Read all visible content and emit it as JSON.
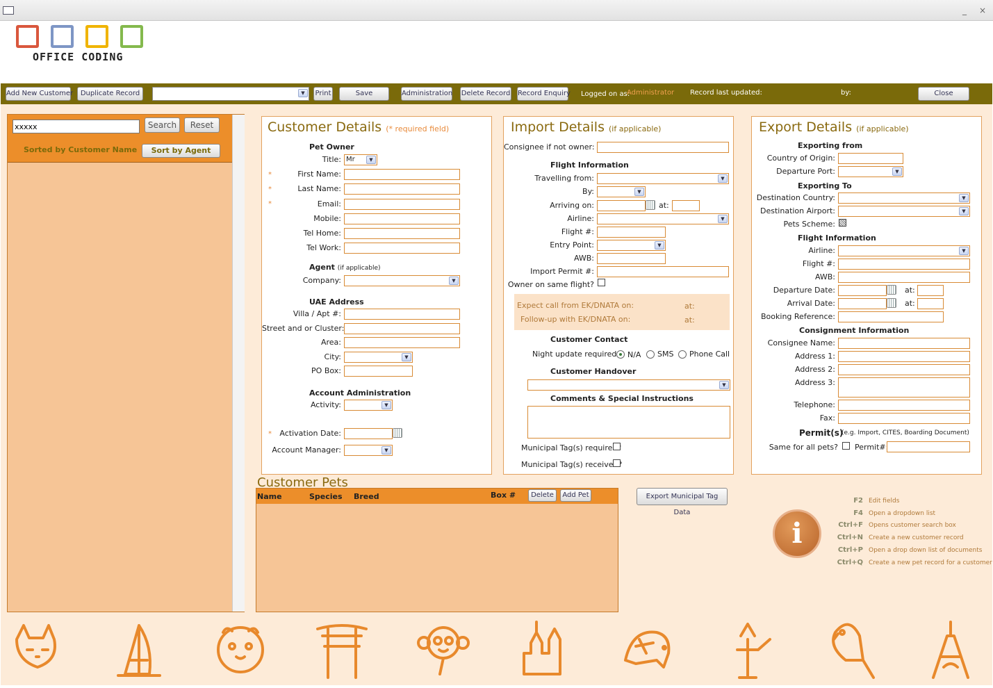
{
  "window": {
    "title_icon": "db-form-icon",
    "minimize": "_",
    "close": "×"
  },
  "logo": {
    "text": "OFFICE CODING",
    "colors": [
      "#d9573d",
      "#7e96c5",
      "#f0b400",
      "#84b94d"
    ]
  },
  "toolbar": {
    "add_new_customer": "Add New Customer",
    "duplicate_record": "Duplicate Record",
    "document_select": "",
    "print": "Print",
    "save": "Save",
    "administration": "Administration",
    "delete_record": "Delete Record",
    "record_enquiry": "Record Enquiry",
    "logged_on_as_label": "Logged on as:",
    "logged_on_as_value": "Administrator",
    "record_last_updated_label": "Record last updated:",
    "by_label": "by:",
    "close": "Close"
  },
  "search": {
    "value": "xxxxx",
    "search_btn": "Search",
    "reset_btn": "Reset",
    "sorted_label": "Sorted by Customer Name",
    "sort_btn": "Sort by Agent"
  },
  "customer": {
    "title": "Customer Details",
    "required_note": "(* required field)",
    "pet_owner": "Pet Owner",
    "title_label": "Title:",
    "title_value": "Mr",
    "first_name": "First Name:",
    "last_name": "Last Name:",
    "email": "Email:",
    "mobile": "Mobile:",
    "tel_home": "Tel Home:",
    "tel_work": "Tel Work:",
    "agent": "Agent",
    "agent_note": "(if applicable)",
    "company": "Company:",
    "uae_address": "UAE Address",
    "villa": "Villa / Apt #:",
    "street": "Street and or Cluster:",
    "area": "Area:",
    "city": "City:",
    "po_box": "PO Box:",
    "account_admin": "Account Administration",
    "activity": "Activity:",
    "activation_date": "Activation Date:",
    "account_manager": "Account Manager:",
    "star": "*"
  },
  "import": {
    "title": "Import Details",
    "note": "(if applicable)",
    "consignee": "Consignee if not owner:",
    "flight_info": "Flight Information",
    "travelling_from": "Travelling from:",
    "by": "By:",
    "arriving_on": "Arriving on:",
    "at": "at:",
    "airline": "Airline:",
    "flight_no": "Flight #:",
    "entry_point": "Entry Point:",
    "awb": "AWB:",
    "import_permit": "Import Permit #:",
    "owner_same_flight": "Owner on same flight?",
    "expect_call": "Expect call from EK/DNATA on:",
    "follow_up": "Follow-up with EK/DNATA on:",
    "customer_contact": "Customer Contact",
    "night_update": "Night update required:",
    "opt_na": "N/A",
    "opt_sms": "SMS",
    "opt_phone": "Phone Call",
    "customer_handover": "Customer Handover",
    "comments": "Comments & Special Instructions",
    "tag_required": "Municipal Tag(s) required?",
    "tag_received": "Municipal Tag(s) received?"
  },
  "export": {
    "title": "Export Details",
    "note": "(if applicable)",
    "exporting_from": "Exporting from",
    "country_origin": "Country of Origin:",
    "departure_port": "Departure Port:",
    "exporting_to": "Exporting To",
    "dest_country": "Destination Country:",
    "dest_airport": "Destination Airport:",
    "pets_scheme": "Pets Scheme:",
    "flight_info": "Flight Information",
    "airline": "Airline:",
    "flight_no": "Flight #:",
    "awb": "AWB:",
    "departure_date": "Departure Date:",
    "arrival_date": "Arrival Date:",
    "at": "at:",
    "booking_ref": "Booking Reference:",
    "consignment_info": "Consignment Information",
    "consignee_name": "Consignee Name:",
    "address1": "Address 1:",
    "address2": "Address 2:",
    "address3": "Address 3:",
    "telephone": "Telephone:",
    "fax": "Fax:",
    "permits": "Permit(s)",
    "permits_note": "(e.g. Import, CITES, Boarding Document)",
    "same_for_all": "Same for all pets?",
    "permit_no": "Permit#:"
  },
  "pets": {
    "title": "Customer Pets",
    "col_name": "Name",
    "col_species": "Species",
    "col_breed": "Breed",
    "col_box": "Box #",
    "delete_btn": "Delete",
    "add_btn": "Add Pet"
  },
  "export_tag_btn": "Export Municipal Tag Data",
  "shortcuts": [
    {
      "key": "F2",
      "desc": "Edit fields"
    },
    {
      "key": "F4",
      "desc": "Open a dropdown list"
    },
    {
      "key": "Ctrl+F",
      "desc": "Opens customer search box"
    },
    {
      "key": "Ctrl+N",
      "desc": "Create a new customer record"
    },
    {
      "key": "Ctrl+P",
      "desc": "Open a drop down list of documents"
    },
    {
      "key": "Ctrl+Q",
      "desc": "Create a new pet record for a customer"
    }
  ],
  "footer_icons": [
    "cat-icon",
    "burj-al-arab-icon",
    "hamster-icon",
    "torii-gate-icon",
    "monkey-icon",
    "castle-icon",
    "tortoise-icon",
    "statue-of-liberty-icon",
    "parrot-icon",
    "eiffel-tower-icon"
  ]
}
